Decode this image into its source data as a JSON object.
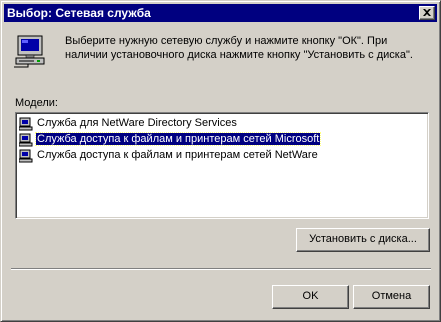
{
  "window": {
    "title": "Выбор: Сетевая служба"
  },
  "instructions": "Выберите нужную сетевую службу и нажмите кнопку \"ОК\". При наличии установочного диска нажмите кнопку \"Установить с диска\".",
  "models": {
    "label": "Модели:",
    "items": [
      {
        "label": "Служба для NetWare Directory Services",
        "selected": false
      },
      {
        "label": "Служба доступа к файлам и принтерам сетей Microsoft",
        "selected": true
      },
      {
        "label": "Служба доступа к файлам и принтерам сетей NetWare",
        "selected": false
      }
    ]
  },
  "buttons": {
    "install_from_disk": "Установить с диска...",
    "ok": "OK",
    "cancel": "Отмена"
  },
  "colors": {
    "titlebar": "#000080",
    "face": "#d4d0c8",
    "selection": "#000080"
  },
  "icons": [
    "close-icon",
    "computer-icon",
    "network-service-icon"
  ]
}
